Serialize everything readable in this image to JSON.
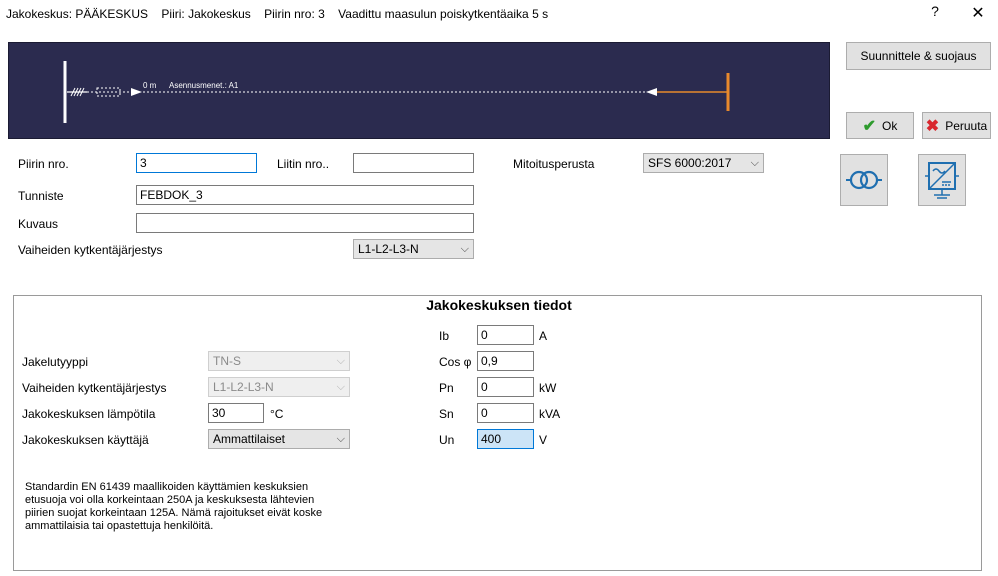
{
  "window": {
    "title_parts": [
      "Jakokeskus: PÄÄKESKUS",
      "Piiri: Jakokeskus",
      "Piirin nro: 3",
      "Vaadittu maasulun poiskytkentäaika 5 s"
    ],
    "help_label": "?",
    "close_label": "✕"
  },
  "diagram": {
    "length_label": "0 m",
    "install_label": "Asennusmenet.: A1",
    "colors": {
      "background": "#2b2b4f",
      "line": "#ffffff",
      "terminal": "#e8892c"
    }
  },
  "actions": {
    "design_label": "Suunnittele & suojaus",
    "ok_label": "Ok",
    "cancel_label": "Peruuta"
  },
  "form": {
    "circuit_no_label": "Piirin nro.",
    "circuit_no_value": "3",
    "connector_no_label": "Liitin nro..",
    "connector_no_value": "",
    "sizing_basis_label": "Mitoitusperusta",
    "sizing_basis_value": "SFS 6000:2017",
    "identifier_label": "Tunniste",
    "identifier_value": "FEBDOK_3",
    "description_label": "Kuvaus",
    "description_value": "",
    "phase_order_label": "Vaiheiden kytkentäjärjestys",
    "phase_order_value": "L1-L2-L3-N"
  },
  "panel": {
    "title": "Jakokeskuksen tiedot",
    "distribution_type_label": "Jakelutyyppi",
    "distribution_type_value": "TN-S",
    "phase_order_label": "Vaiheiden kytkentäjärjestys",
    "phase_order_value": "L1-L2-L3-N",
    "temperature_label": "Jakokeskuksen lämpötila",
    "temperature_value": "30",
    "temperature_unit": "°C",
    "user_label": "Jakokeskuksen käyttäjä",
    "user_value": "Ammattilaiset",
    "ib_label": "Ib",
    "ib_value": "0",
    "ib_unit": "A",
    "cos_label": "Cos φ",
    "cos_value": "0,9",
    "pn_label": "Pn",
    "pn_value": "0",
    "pn_unit": "kW",
    "sn_label": "Sn",
    "sn_value": "0",
    "sn_unit": "kVA",
    "un_label": "Un",
    "un_value": "400",
    "un_unit": "V",
    "info_text": "Standardin EN 61439 maallikoiden käyttämien keskuksien etusuoja voi olla korkeintaan 250A ja keskuksesta lähtevien piirien suojat korkeintaan 125A. Nämä rajoitukset eivät koske ammattilaisia tai opastettuja henkilöitä."
  }
}
